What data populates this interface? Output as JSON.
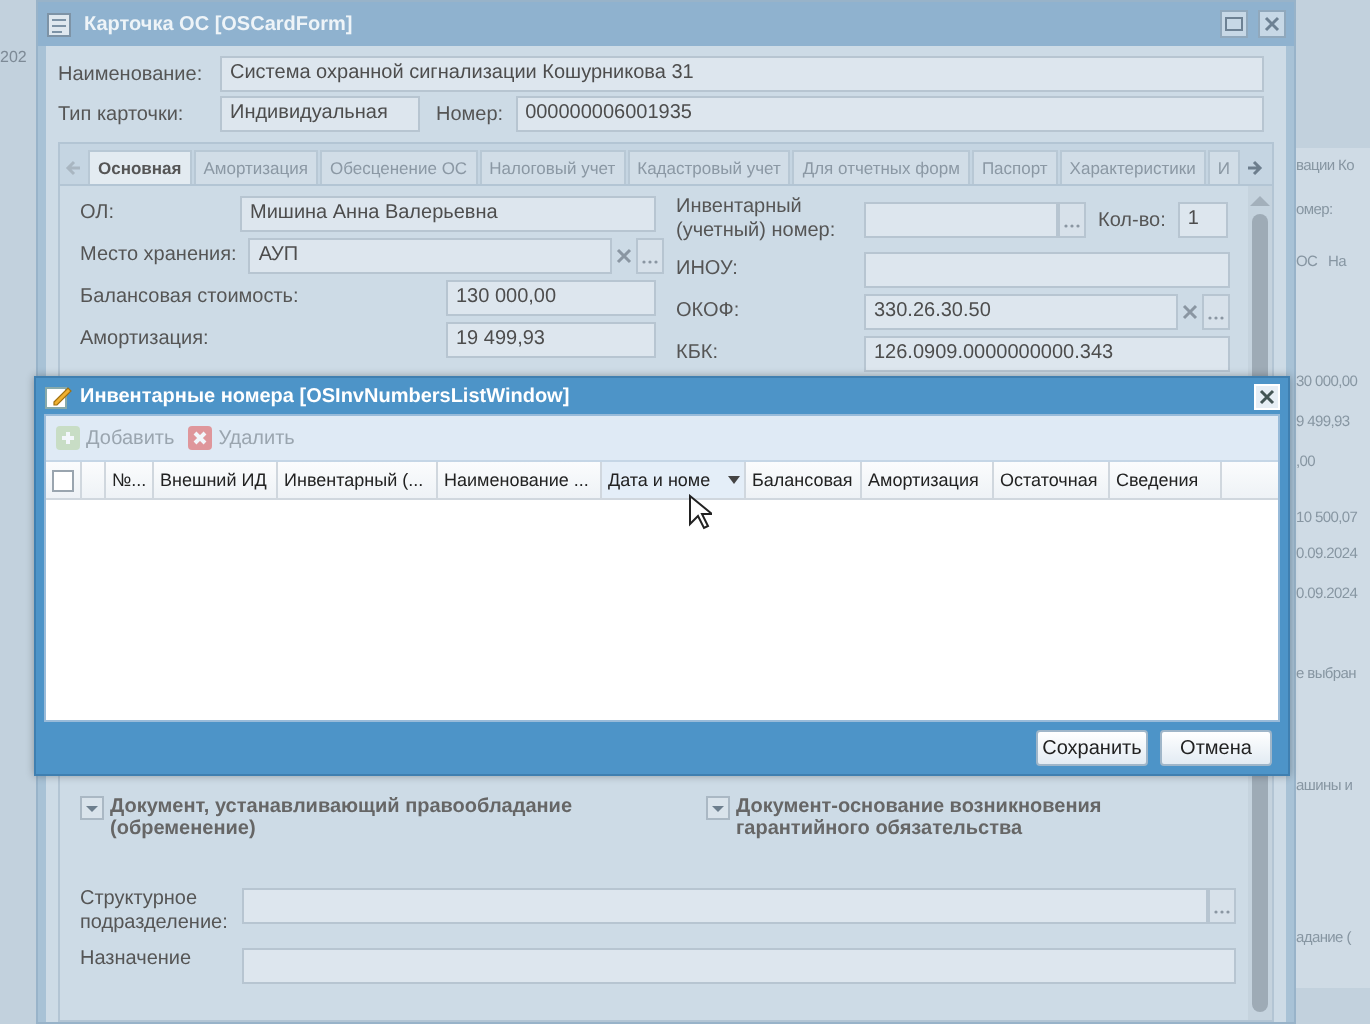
{
  "desktop": {
    "left_fragments": [
      "202"
    ],
    "right_fragments": [
      "вации Ко",
      "омер:",
      "ОС",
      "На",
      "30 000,00",
      "9 499,93",
      ",00",
      "10 500,07",
      "0.09.2024",
      "0.09.2024",
      "е выбран",
      "ашины и",
      "адание ("
    ]
  },
  "card_window": {
    "title": "Карточка ОС [OSCardForm]",
    "header_fields": [
      {
        "label": "Наименование:",
        "value": "Система охранной сигнализации Кошурникова 31",
        "kind": "wide"
      },
      {
        "label": "Тип карточки:",
        "value": "Индивидуальная",
        "kind": "short",
        "second": {
          "label": "Номер:",
          "value": "000000006001935"
        }
      }
    ],
    "tabs": [
      {
        "label": "Основная",
        "selected": true
      },
      {
        "label": "Амортизация",
        "selected": false
      },
      {
        "label": "Обесценение ОС",
        "selected": false
      },
      {
        "label": "Налоговый учет",
        "selected": false
      },
      {
        "label": "Кадастровый учет",
        "selected": false
      },
      {
        "label": "Для отчетных форм",
        "selected": false
      },
      {
        "label": "Паспорт",
        "selected": false
      },
      {
        "label": "Характеристики",
        "selected": false
      },
      {
        "label": "И",
        "selected": false
      }
    ],
    "left_fields": [
      {
        "label": "ОЛ:",
        "value": "Мишина Анна Валерьевна",
        "kind": "wide",
        "clearable": false,
        "browse": false
      },
      {
        "label": "Место хранения:",
        "value": "АУП",
        "kind": "wide",
        "clearable": true,
        "browse": true
      },
      {
        "label": "Балансовая стоимость:",
        "value": "130 000,00",
        "kind": "short",
        "clearable": false,
        "browse": false
      },
      {
        "label": "Амортизация:",
        "value": "19 499,93",
        "kind": "short",
        "clearable": false,
        "browse": false
      }
    ],
    "right_fields": [
      {
        "label": "Инвентарный (учетный) номер:",
        "kind": "short",
        "clearable": false,
        "browse": true,
        "quantity": {
          "label": "Кол-во:",
          "value": "1"
        }
      },
      {
        "label": "ИНОУ:",
        "kind": "wide",
        "clearable": false,
        "browse": false
      },
      {
        "label": "ОКОФ:",
        "value": "330.26.30.50",
        "kind": "wide",
        "clearable": true,
        "browse": true
      },
      {
        "label": "КБК:",
        "value": "126.0909.0000000000.343",
        "kind": "wide",
        "clearable": false,
        "browse": false
      }
    ],
    "fieldsets": [
      {
        "title": "Документ, устанавливающий правообладание (обременение)",
        "expanded": false
      },
      {
        "title": "Документ-основание возникновения гарантийного обязательства",
        "expanded": false
      }
    ],
    "lower_fields": [
      {
        "label": "Структурное подразделение:",
        "browse": true
      },
      {
        "label": "Назначение",
        "browse": false
      }
    ]
  },
  "dialog": {
    "title": "Инвентарные номера [OSInvNumbersListWindow]",
    "toolbar": [
      {
        "label": "Добавить",
        "kind": "add",
        "disabled": true
      },
      {
        "label": "Удалить",
        "kind": "delete",
        "disabled": true
      }
    ],
    "columns": [
      {
        "kind": "checkbox",
        "checked": false
      },
      {
        "kind": "blank"
      },
      {
        "label": "№..."
      },
      {
        "label": "Внешний ИД"
      },
      {
        "label": "Инвентарный (..."
      },
      {
        "label": "Наименование ..."
      },
      {
        "label": "Дата и номе",
        "hovered": true
      },
      {
        "label": "Балансовая"
      },
      {
        "label": "Амортизация"
      },
      {
        "label": "Остаточная"
      },
      {
        "label": "Сведения"
      }
    ],
    "buttons": [
      "Сохранить",
      "Отмена"
    ]
  }
}
